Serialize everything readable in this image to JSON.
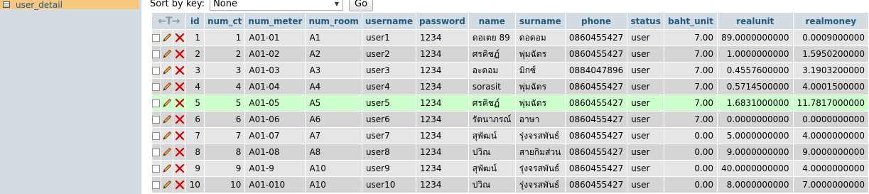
{
  "sidebar": {
    "item_label": "user_detail",
    "item_icon": "table-icon"
  },
  "sortbar": {
    "label": "Sort by key:",
    "selected": "None",
    "go_label": "Go"
  },
  "table": {
    "header_arrows": "←T→",
    "columns": [
      "id",
      "num_ct",
      "num_meter",
      "num_room",
      "username",
      "password",
      "name",
      "surname",
      "phone",
      "status",
      "baht_unit",
      "realunit",
      "realmoney"
    ],
    "rows": [
      [
        "1",
        "1",
        "A01-01",
        "A1",
        "user1",
        "1234",
        "ดอเตย 89",
        "ดอดอม",
        "0860455427",
        "user",
        "7.00",
        "89.0000000000",
        "0.0009000000"
      ],
      [
        "2",
        "2",
        "A01-02",
        "A2",
        "user2",
        "1234",
        "ศรคิชฏ์",
        "พุ่มฉัตร",
        "0860455427",
        "user",
        "7.00",
        "1.0000000000",
        "1.5950200000"
      ],
      [
        "3",
        "3",
        "A01-03",
        "A3",
        "user3",
        "1234",
        "อะดอม",
        "มิกซ์",
        "0884047896",
        "user",
        "7.00",
        "0.4557600000",
        "3.1903200000"
      ],
      [
        "4",
        "4",
        "A01-04",
        "A4",
        "user4",
        "1234",
        "sorasit",
        "พุ่มฉัตร",
        "0860455427",
        "user",
        "7.00",
        "0.5714500000",
        "4.0001500000"
      ],
      [
        "5",
        "5",
        "A01-05",
        "A5",
        "user5",
        "1234",
        "ศรคิชฏ์",
        "พุ่มฉัตร",
        "0860455427",
        "user",
        "7.00",
        "1.6831000000",
        "11.7817000000"
      ],
      [
        "6",
        "6",
        "A01-06",
        "A6",
        "user6",
        "1234",
        "รัตนาภรณ์",
        "อาษา",
        "0860455427",
        "user",
        "7.00",
        "0.0000000000",
        "0.0000000000"
      ],
      [
        "7",
        "7",
        "A01-07",
        "A7",
        "user7",
        "1234",
        "สุพัฒน์",
        "รุ่งจรสพันธ์",
        "0860455427",
        "user",
        "0.00",
        "5.0000000000",
        "4.0000000000"
      ],
      [
        "8",
        "8",
        "A01-08",
        "A8",
        "user8",
        "1234",
        "ปวิณ",
        "สายกิมส่วน",
        "0860455427",
        "user",
        "0.00",
        "9.0000000000",
        "9.0000000000"
      ],
      [
        "9",
        "9",
        "A01-9",
        "A10",
        "user9",
        "1234",
        "สุพัฒน์",
        "รุ่งจรสพันธ์",
        "0860455427",
        "user",
        "0.00",
        "40.0000000000",
        "4.0000000000"
      ],
      [
        "10",
        "10",
        "A01-010",
        "A10",
        "user10",
        "1234",
        "ปวิณ",
        "รุ่งจรสพันธ์",
        "0860455427",
        "user",
        "0.00",
        "8.0000000000",
        "7.0000000000"
      ]
    ],
    "highlighted_row": 4,
    "row_icons": [
      "checkbox",
      "pencil-edit-icon",
      "delete-x-icon"
    ]
  },
  "colors": {
    "sidebar_bg": "#d3dce3",
    "sidebar_active": "#f7c780",
    "header_bg": "#d3dce3",
    "header_text": "#235a81",
    "row_odd": "#e5e5e5",
    "row_even": "#d5d5d5",
    "row_highlight": "#ccffcc",
    "delete_red": "#cc0000"
  }
}
